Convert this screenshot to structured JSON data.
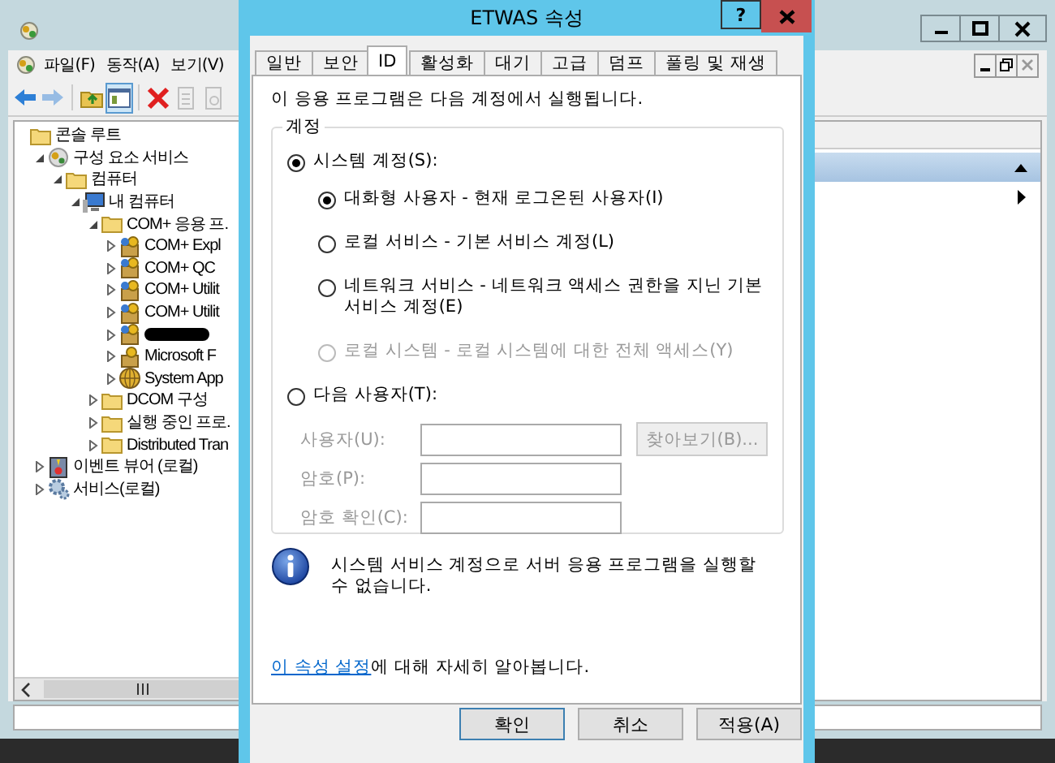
{
  "console": {
    "menu": [
      "파일(F)",
      "동작(A)",
      "보기(V)"
    ],
    "toolbar": [
      {
        "kind": "back",
        "pressed": false,
        "disabled": false
      },
      {
        "kind": "forward",
        "pressed": false,
        "disabled": true
      },
      {
        "kind": "up",
        "pressed": false,
        "disabled": false
      },
      {
        "kind": "tree-pane",
        "pressed": true,
        "disabled": false
      },
      {
        "kind": "delete",
        "pressed": false,
        "disabled": false
      },
      {
        "kind": "export",
        "pressed": false,
        "disabled": true
      },
      {
        "kind": "properties",
        "pressed": false,
        "disabled": true
      }
    ],
    "tree": [
      {
        "label": "콘솔 루트",
        "kind": "folder",
        "children": [
          {
            "label": "구성 요소 서비스",
            "kind": "component",
            "expanded": true,
            "children": [
              {
                "label": "컴퓨터",
                "kind": "folder",
                "expanded": true,
                "children": [
                  {
                    "label": "내 컴퓨터",
                    "kind": "computer",
                    "expanded": true,
                    "children": [
                      {
                        "label": "COM+ 응용 프.",
                        "kind": "folder",
                        "expanded": true,
                        "children": [
                          {
                            "label": "COM+ Expl",
                            "kind": "app",
                            "expanded": false
                          },
                          {
                            "label": "COM+ QC",
                            "kind": "app",
                            "expanded": false
                          },
                          {
                            "label": "COM+ Utilit",
                            "kind": "app",
                            "expanded": false
                          },
                          {
                            "label": "COM+ Utilit",
                            "kind": "app",
                            "expanded": false
                          },
                          {
                            "kind": "redacted",
                            "expanded": false
                          },
                          {
                            "label": "Microsoft F",
                            "kind": "box",
                            "expanded": false
                          },
                          {
                            "label": "System App",
                            "kind": "globe",
                            "expanded": false
                          }
                        ]
                      },
                      {
                        "label": "DCOM 구성",
                        "kind": "folder",
                        "expanded": false
                      },
                      {
                        "label": "실행 중인 프로.",
                        "kind": "folder",
                        "expanded": false
                      },
                      {
                        "label": "Distributed Tran",
                        "kind": "folder",
                        "expanded": false
                      }
                    ]
                  }
                ]
              }
            ]
          },
          {
            "label": "이벤트 뷰어 (로컬)",
            "kind": "event",
            "expanded": false
          },
          {
            "label": "서비스(로컬)",
            "kind": "services",
            "expanded": false
          }
        ]
      }
    ]
  },
  "dialog": {
    "title": "ETWAS 속성",
    "help_button": "?",
    "tabs": [
      {
        "label": "일반",
        "selected": false
      },
      {
        "label": "보안",
        "selected": false
      },
      {
        "label": "ID",
        "selected": true
      },
      {
        "label": "활성화",
        "selected": false
      },
      {
        "label": "대기",
        "selected": false
      },
      {
        "label": "고급",
        "selected": false
      },
      {
        "label": "덤프",
        "selected": false
      },
      {
        "label": "풀링 및 재생",
        "selected": false
      }
    ],
    "intro": "이 응용 프로그램은 다음 계정에서 실행됩니다.",
    "account_group": {
      "label": "계정",
      "options": [
        {
          "label": "시스템 계정(S):",
          "selected": true,
          "sub_options": [
            {
              "label": "대화형 사용자 - 현재 로그온된 사용자(I)",
              "selected": true,
              "disabled": false
            },
            {
              "label": "로컬 서비스 - 기본 서비스 계정(L)",
              "selected": false,
              "disabled": false
            },
            {
              "label": "네트워크 서비스 - 네트워크 액세스 권한을 지닌 기본 서비스 계정(E)",
              "selected": false,
              "disabled": false
            },
            {
              "label": "로컬 시스템 - 로컬 시스템에 대한 전체 액세스(Y)",
              "selected": false,
              "disabled": true
            }
          ]
        },
        {
          "label": "다음 사용자(T):",
          "selected": false
        }
      ],
      "user_fields": [
        {
          "label": "사용자(U):",
          "disabled": true
        },
        {
          "label": "암호(P):",
          "disabled": true
        },
        {
          "label": "암호 확인(C):",
          "disabled": true
        }
      ],
      "browse_button": {
        "label": "찾아보기(B)...",
        "disabled": true
      }
    },
    "info": "시스템 서비스 계정으로 서버 응용 프로그램을 실행할 수 없습니다.",
    "help_link": {
      "link": "이 속성 설정",
      "text": "에 대해 자세히 알아봅니다."
    },
    "buttons": [
      {
        "label": "확인",
        "default": true
      },
      {
        "label": "취소",
        "default": false
      },
      {
        "label": "적용(A)",
        "default": false
      }
    ]
  }
}
